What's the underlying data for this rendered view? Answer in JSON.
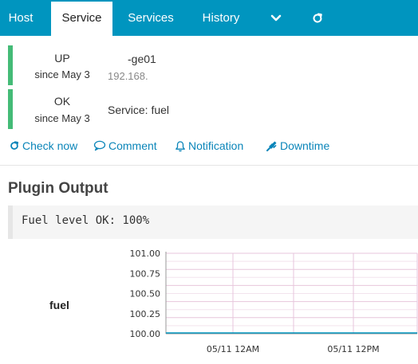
{
  "tabs": [
    {
      "label": "Host",
      "active": false
    },
    {
      "label": "Service",
      "active": true
    },
    {
      "label": "Services",
      "active": false
    },
    {
      "label": "History",
      "active": false
    }
  ],
  "tab_icons": [
    "chevron-down-icon",
    "refresh-icon"
  ],
  "host_row": {
    "state": "UP",
    "since": "since May 3",
    "name": "-ge01",
    "address": "192.168."
  },
  "service_row": {
    "state": "OK",
    "since": "since May 3",
    "name": "Service: fuel"
  },
  "state_color": "#44bb77",
  "accent_color": "#0095bf",
  "actions": [
    {
      "label": "Check now",
      "icon": "refresh-icon"
    },
    {
      "label": "Comment",
      "icon": "comment-icon"
    },
    {
      "label": "Notification",
      "icon": "bell-icon"
    },
    {
      "label": "Downtime",
      "icon": "plug-icon"
    }
  ],
  "plugin_output": {
    "title": "Plugin Output",
    "text": "Fuel level OK: 100%"
  },
  "perfdata": {
    "metric_label": "fuel"
  },
  "chart_data": {
    "type": "line",
    "title": "",
    "xlabel": "",
    "ylabel": "",
    "x_ticks": [
      "05/11 12AM",
      "05/11 12PM"
    ],
    "y_ticks": [
      "101.00",
      "100.75",
      "100.50",
      "100.25",
      "100.00"
    ],
    "ylim": [
      100.0,
      101.0
    ],
    "grid": true,
    "series": [
      {
        "values": [
          100,
          100,
          100,
          100,
          100
        ],
        "color": "#0095bf"
      }
    ]
  }
}
